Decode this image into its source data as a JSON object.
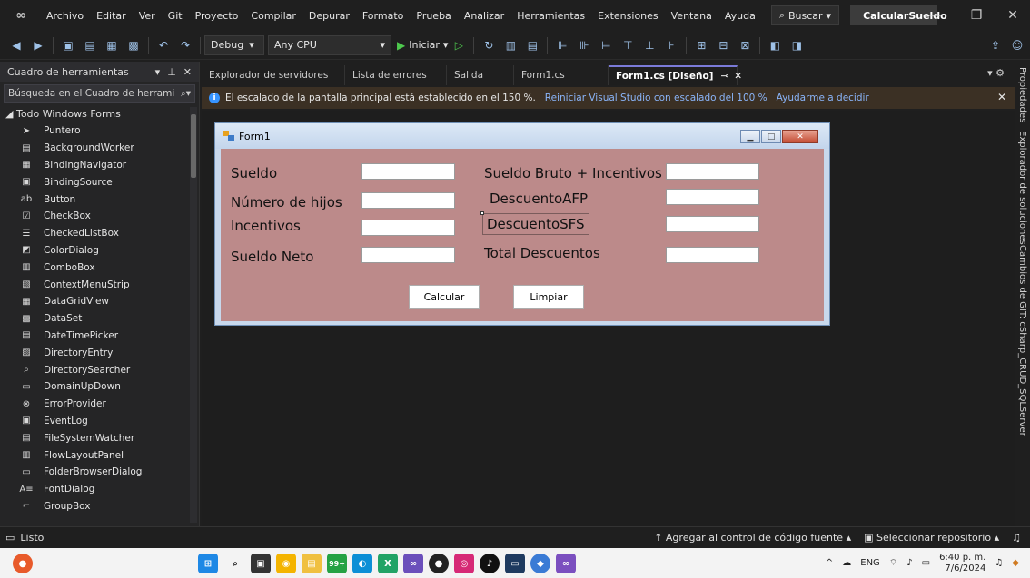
{
  "menu": [
    "Archivo",
    "Editar",
    "Ver",
    "Git",
    "Proyecto",
    "Compilar",
    "Depurar",
    "Formato",
    "Prueba",
    "Analizar",
    "Herramientas",
    "Extensiones",
    "Ventana",
    "Ayuda"
  ],
  "search_label": "Buscar",
  "solution_name": "CalcularSueldo",
  "toolbar": {
    "config": "Debug",
    "platform": "Any CPU",
    "start": "Iniciar"
  },
  "toolbox": {
    "title": "Cuadro de herramientas",
    "search_placeholder": "Búsqueda en el Cuadro de herrami",
    "group": "Todo Windows Forms",
    "items": [
      "Puntero",
      "BackgroundWorker",
      "BindingNavigator",
      "BindingSource",
      "Button",
      "CheckBox",
      "CheckedListBox",
      "ColorDialog",
      "ComboBox",
      "ContextMenuStrip",
      "DataGridView",
      "DataSet",
      "DateTimePicker",
      "DirectoryEntry",
      "DirectorySearcher",
      "DomainUpDown",
      "ErrorProvider",
      "EventLog",
      "FileSystemWatcher",
      "FlowLayoutPanel",
      "FolderBrowserDialog",
      "FontDialog",
      "GroupBox"
    ],
    "icons": [
      "➤",
      "▤",
      "▦",
      "▣",
      "ab",
      "☑",
      "☰",
      "◩",
      "▥",
      "▧",
      "▦",
      "▩",
      "▤",
      "▨",
      "⌕",
      "▭",
      "⊗",
      "▣",
      "▤",
      "▥",
      "▭",
      "A≡",
      "⌐"
    ]
  },
  "tabs": [
    "Explorador de servidores",
    "Lista de errores",
    "Salida",
    "Form1.cs"
  ],
  "active_tab": "Form1.cs [Diseño]",
  "infobar": {
    "message": "El escalado de la pantalla principal está establecido en el 150 %.",
    "link1": "Reiniciar Visual Studio con escalado del 100 %",
    "link2": "Ayudarme a decidir"
  },
  "form": {
    "title": "Form1",
    "labels": {
      "sueldo": "Sueldo",
      "hijos": "Número de hijos",
      "incentivos": "Incentivos",
      "neto": "Sueldo Neto",
      "bruto": "Sueldo Bruto + Incentivos",
      "afp": "DescuentoAFP",
      "sfs": "DescuentoSFS",
      "total": "Total Descuentos"
    },
    "buttons": {
      "calcular": "Calcular",
      "limpiar": "Limpiar"
    }
  },
  "side_panels": [
    "Propiedades",
    "Explorador de soluciones",
    "Cambios de GIT: cSharp_CRUD_SQLServer"
  ],
  "status": {
    "left": "Listo",
    "source_control": "Agregar al control de código fuente",
    "repository": "Seleccionar repositorio"
  },
  "taskbar": {
    "notification_count": "99+",
    "language": "ENG",
    "time": "6:40 p. m.",
    "date": "7/6/2024"
  }
}
